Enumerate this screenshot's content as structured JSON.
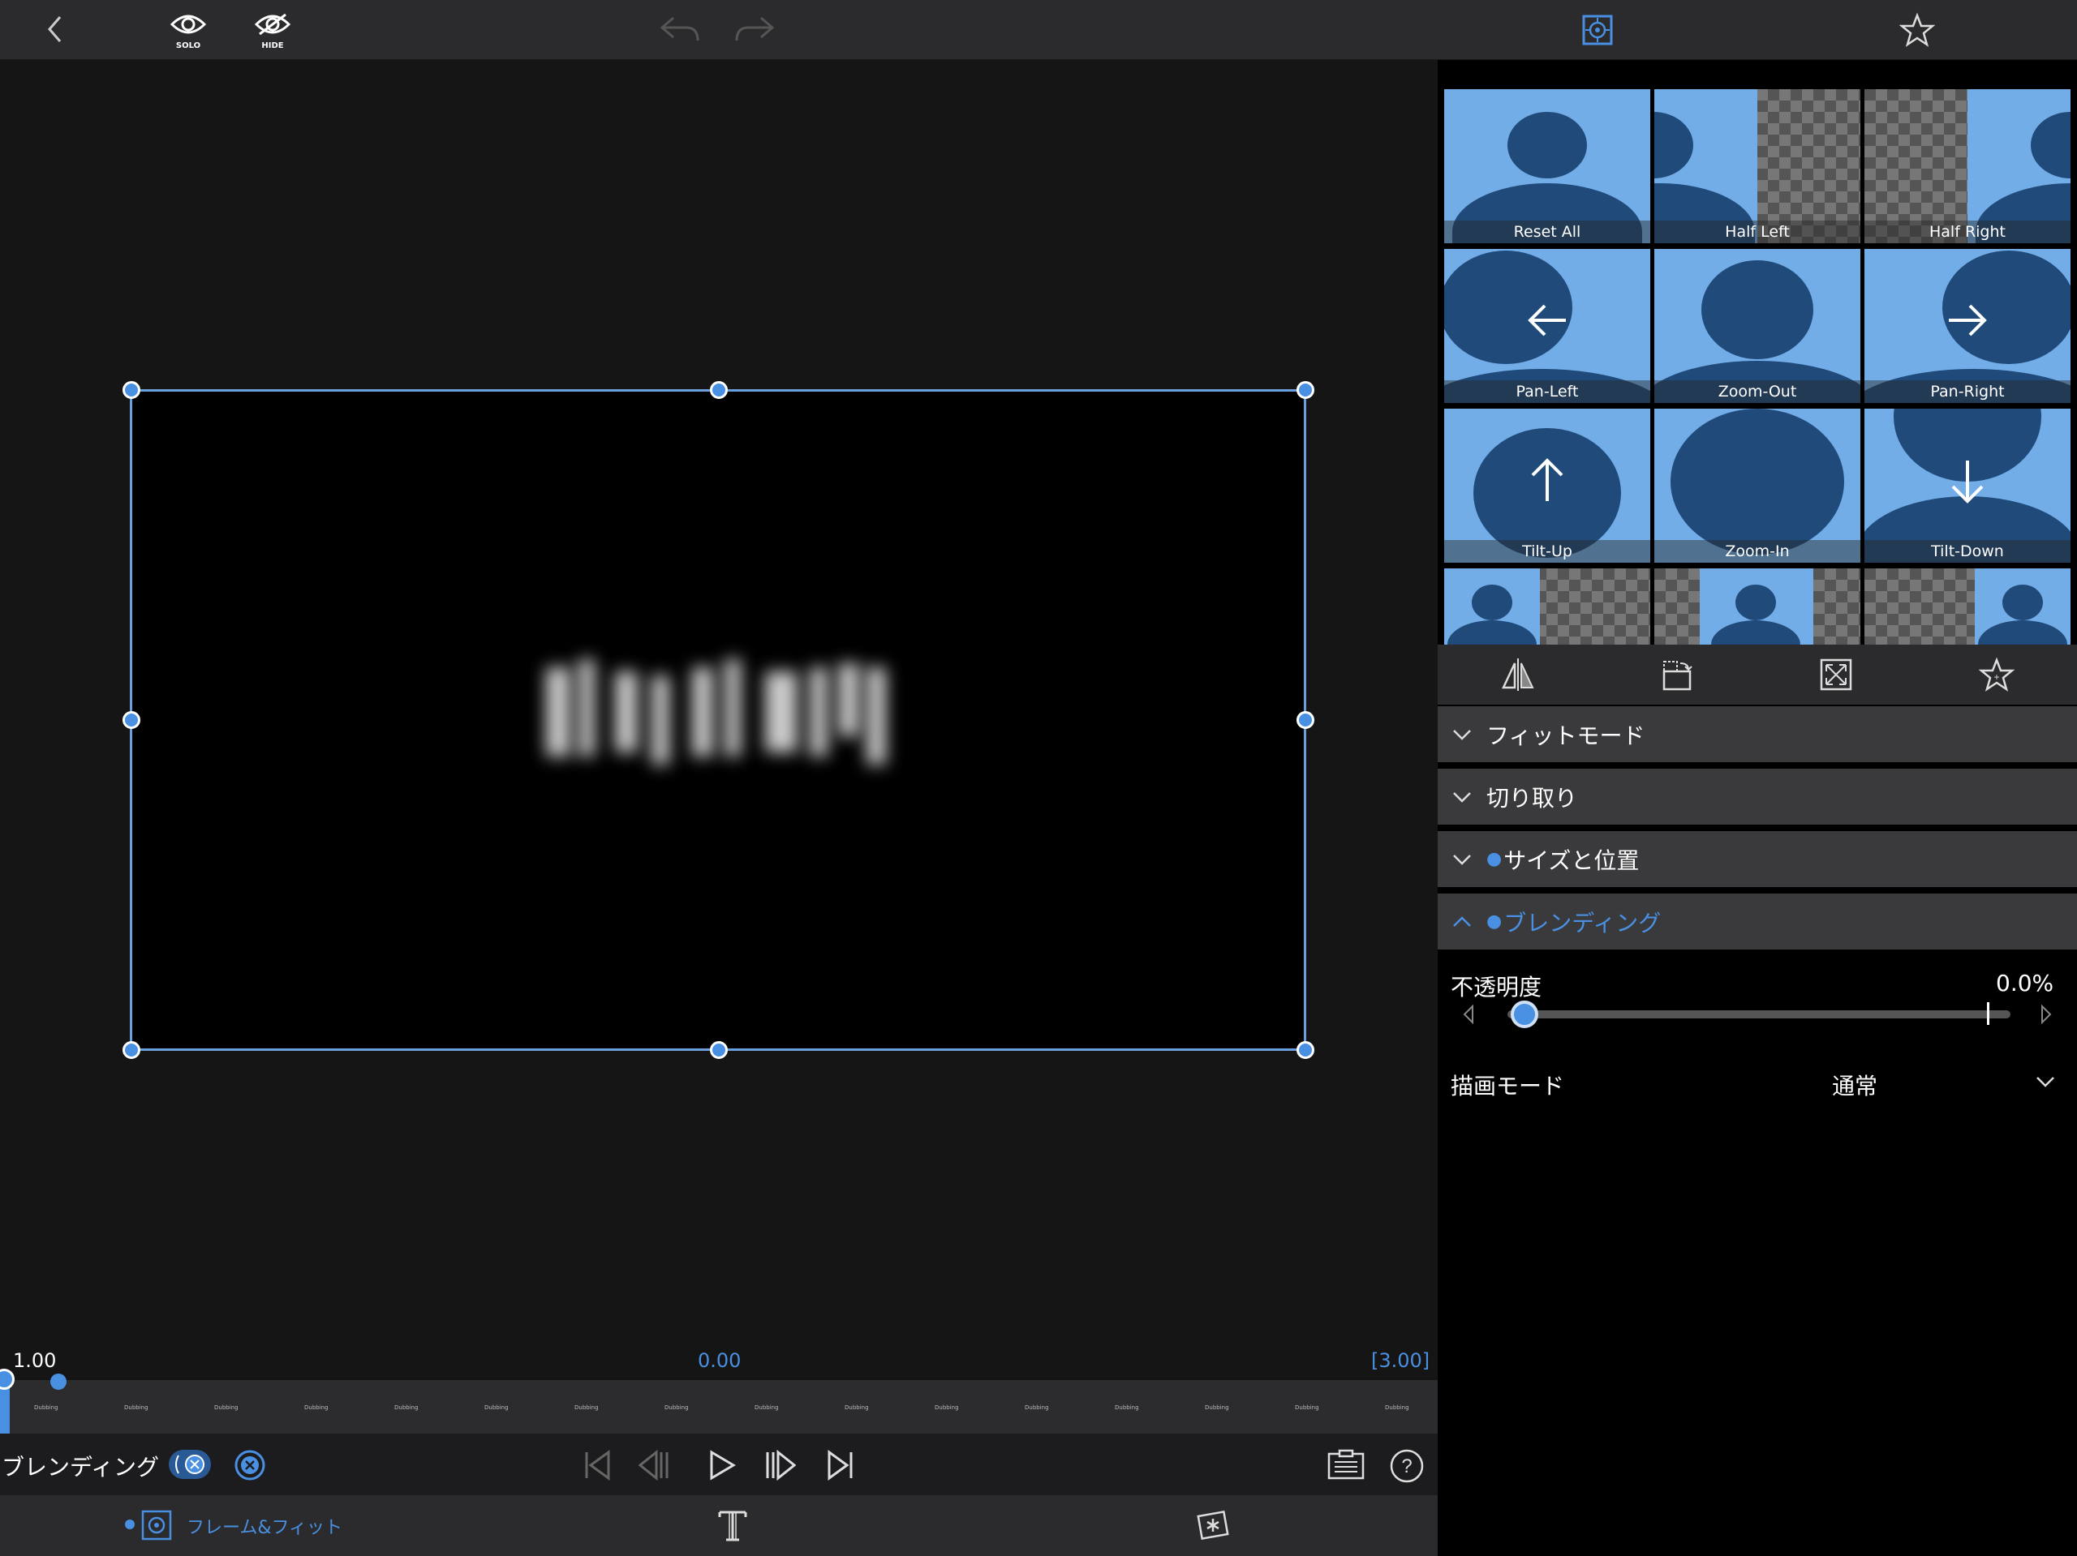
{
  "topbar": {
    "solo_label": "SOLO",
    "hide_label": "HIDE",
    "icons": [
      "back-icon",
      "solo-eye-icon",
      "hide-eye-icon",
      "undo-icon",
      "redo-icon",
      "frame-fit-target-icon",
      "favorites-star-icon"
    ]
  },
  "timeline": {
    "left_value": "1.00",
    "center_value": "0.00",
    "right_value": "[3.00]",
    "keyframe_label": "Dubbing"
  },
  "controls": {
    "effect_label": "ブレンディング"
  },
  "tabbar": {
    "frame_fit_label": "フレーム&フィット"
  },
  "presets": [
    {
      "label": "Reset All"
    },
    {
      "label": "Half Left"
    },
    {
      "label": "Half Right"
    },
    {
      "label": "Pan-Left"
    },
    {
      "label": "Zoom-Out"
    },
    {
      "label": "Pan-Right"
    },
    {
      "label": "Tilt-Up"
    },
    {
      "label": "Zoom-In"
    },
    {
      "label": "Tilt-Down"
    }
  ],
  "sections": {
    "fit_mode": "フィットモード",
    "crop": "切り取り",
    "size_position": "サイズと位置",
    "blending": "ブレンディング"
  },
  "blending": {
    "opacity_label": "不透明度",
    "opacity_value": "0.0%",
    "opacity_fraction": 0.0,
    "draw_mode_label": "描画モード",
    "draw_mode_value": "通常"
  },
  "colors": {
    "accent": "#4a90e2",
    "panel": "#3a3a3c",
    "toolbar": "#2b2b2d",
    "preset_bg": "#73ade8",
    "silhouette": "#1f4a7a"
  }
}
